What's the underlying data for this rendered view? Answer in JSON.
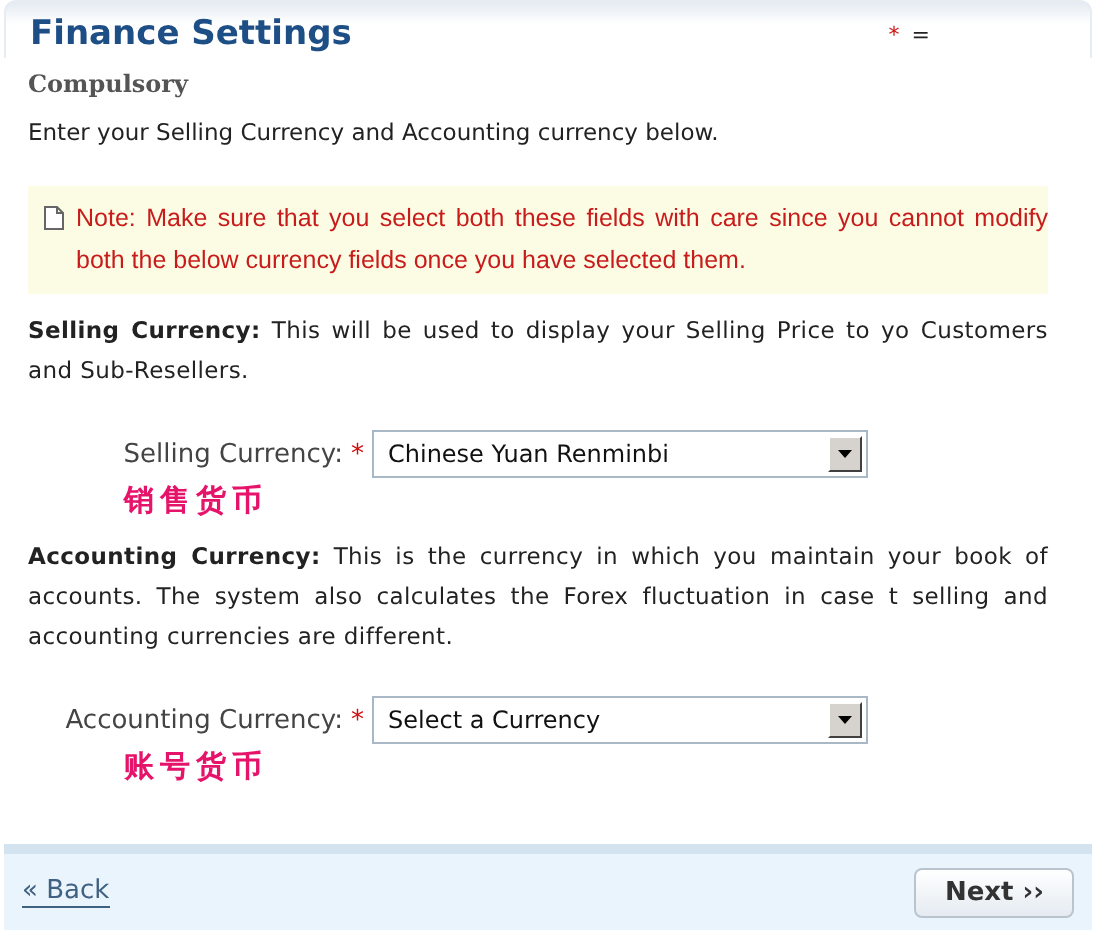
{
  "header": {
    "title": "Finance Settings",
    "legend_mark": "*",
    "legend_text": "="
  },
  "subtitle": "Compulsory",
  "intro": "Enter your Selling Currency and Accounting currency below.",
  "note": "Note: Make sure that you select both these fields with care since you cannot modify both the below currency fields once you have selected them.",
  "sections": [
    {
      "description": "**Selling Currency:** This will be used to display your Selling Price to yo Customers and Sub-Resellers.",
      "label": "Selling Currency:",
      "required_mark": "*",
      "value": "Chinese Yuan Renminbi",
      "annotation": "销售货币"
    },
    {
      "description": "**Accounting Currency:** This is the currency in which you maintain your book of accounts. The system also calculates the Forex fluctuation in case t selling and accounting currencies are different.",
      "label": "Accounting Currency:",
      "required_mark": "*",
      "value": "Select a Currency",
      "annotation": "账号货币"
    }
  ],
  "footer": {
    "back": "« Back",
    "next": "Next ››"
  }
}
